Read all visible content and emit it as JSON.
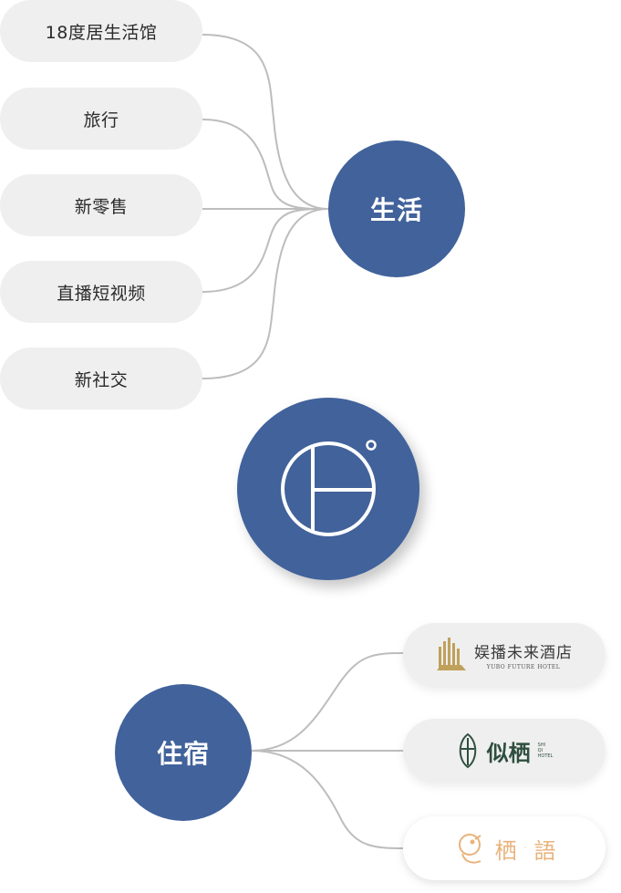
{
  "life_hub": {
    "label": "生活"
  },
  "life_items": [
    {
      "label": "18度居生活馆"
    },
    {
      "label": "旅行"
    },
    {
      "label": "新零售"
    },
    {
      "label": "直播短视频"
    },
    {
      "label": "新社交"
    }
  ],
  "center_logo": {
    "icon": "brand-logo-icon"
  },
  "stay_hub": {
    "label": "住宿"
  },
  "stay_brands": [
    {
      "name": "娱播未来酒店",
      "subtitle": "YUBO FUTURE HOTEL"
    },
    {
      "name": "似栖",
      "small": [
        "SHI",
        "QI",
        "HOTEL"
      ]
    },
    {
      "name": "栖",
      "separator": "·",
      "name2": "語"
    }
  ],
  "colors": {
    "hub": "#41629b",
    "pill_bg": "#efefef",
    "connector": "#bdbdbd",
    "gold": "#c0a15c",
    "green": "#2f4f3f",
    "peach": "#e8b37c"
  }
}
